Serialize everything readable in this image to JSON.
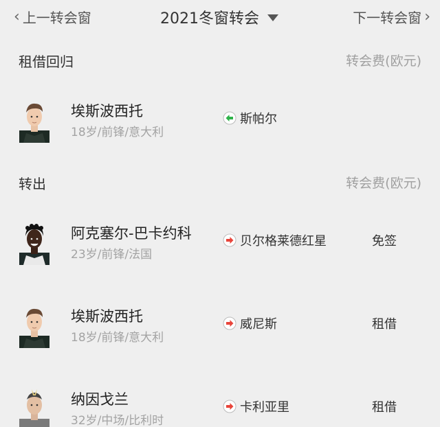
{
  "nav": {
    "prev_label": "上一转会窗",
    "title": "2021冬窗转会",
    "next_label": "下一转会窗"
  },
  "sections": [
    {
      "title": "租借回归",
      "fee_header": "转会费(欧元)",
      "rows": [
        {
          "name": "埃斯波西托",
          "meta": "18岁/前锋/意大利",
          "direction": "in",
          "club": "斯帕尔",
          "fee": ""
        }
      ]
    },
    {
      "title": "转出",
      "fee_header": "转会费(欧元)",
      "rows": [
        {
          "name": "阿克塞尔-巴卡约科",
          "meta": "23岁/前锋/法国",
          "direction": "out",
          "club": "贝尔格莱德红星",
          "fee": "免签"
        },
        {
          "name": "埃斯波西托",
          "meta": "18岁/前锋/意大利",
          "direction": "out",
          "club": "威尼斯",
          "fee": "租借"
        },
        {
          "name": "纳因戈兰",
          "meta": "32岁/中场/比利时",
          "direction": "out",
          "club": "卡利亚里",
          "fee": "租借"
        }
      ]
    }
  ],
  "colors": {
    "in_arrow": "#2fb34a",
    "out_arrow": "#e8443a",
    "background": "#efefef"
  },
  "icons": {
    "prev": "chevron-left-icon",
    "next": "chevron-right-icon",
    "dropdown": "caret-down-icon",
    "in": "arrow-left-in-icon",
    "out": "arrow-right-out-icon"
  }
}
